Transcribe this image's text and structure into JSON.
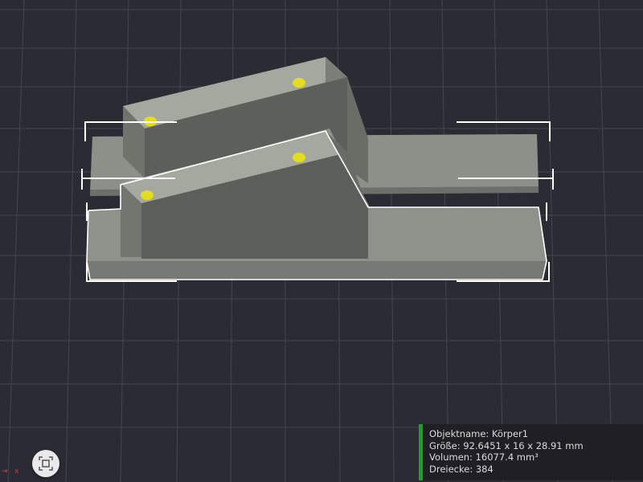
{
  "viewport": {
    "background": "#2b2b33",
    "grid_color": "#4a4a55",
    "model_face_top": "#9a9d94",
    "model_face_side": "#6f716b",
    "model_face_front": "#565853",
    "marker_color": "#e6dc1e",
    "selection_color": "#ffffff"
  },
  "axis": {
    "x_label": "x"
  },
  "info_panel": {
    "accent": "#14a32c",
    "object_name": "Objektname: Körper1",
    "size": "Größe: 92.6451 x 16 x 28.91 mm",
    "volume": "Volumen: 16077.4 mm³",
    "triangles": "Dreiecke: 384"
  },
  "controls": {
    "view_cube_icon": "view-cube-icon"
  }
}
